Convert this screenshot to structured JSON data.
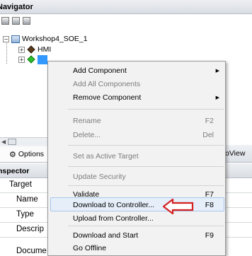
{
  "navigator": {
    "title": "Navigator",
    "tree": {
      "project": "Workshop4_SOE_1",
      "nodes": [
        {
          "label": "HMI"
        },
        {
          "label": ""
        }
      ]
    }
  },
  "tabs": {
    "options_label": "Options",
    "right_label": "oView"
  },
  "inspector": {
    "title": "nspector",
    "rows": [
      "Target",
      "Name",
      "Type",
      "Descrip",
      "Docume"
    ]
  },
  "context_menu": {
    "items": [
      {
        "label": "Add Component",
        "shortcut": "",
        "submenu": true,
        "disabled": false
      },
      {
        "label": "Add All Components",
        "shortcut": "",
        "submenu": false,
        "disabled": true
      },
      {
        "label": "Remove Component",
        "shortcut": "",
        "submenu": true,
        "disabled": false
      },
      {
        "label": "Rename",
        "shortcut": "F2",
        "submenu": false,
        "disabled": true
      },
      {
        "label": "Delete...",
        "shortcut": "Del",
        "submenu": false,
        "disabled": true
      },
      {
        "label": "Set as Active Target",
        "shortcut": "",
        "submenu": false,
        "disabled": true
      },
      {
        "label": "Update Security",
        "shortcut": "",
        "submenu": false,
        "disabled": true
      },
      {
        "label": "Validate",
        "shortcut": "F7",
        "submenu": false,
        "disabled": false
      },
      {
        "label": "Download to Controller...",
        "shortcut": "F8",
        "submenu": false,
        "disabled": false
      },
      {
        "label": "Upload from Controller...",
        "shortcut": "",
        "submenu": false,
        "disabled": false
      },
      {
        "label": "Download and Start",
        "shortcut": "F9",
        "submenu": false,
        "disabled": false
      },
      {
        "label": "Go Offline",
        "shortcut": "",
        "submenu": false,
        "disabled": false
      }
    ],
    "highlighted_index": 8
  },
  "colors": {
    "callout_arrow": "#d42121",
    "selection": "#3399ff",
    "menu_hover": "#e5eef9"
  }
}
